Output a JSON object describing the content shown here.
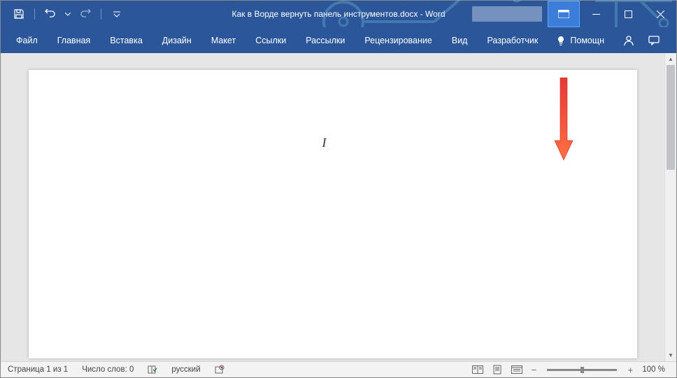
{
  "title": {
    "document": "Как в Ворде вернуть панель инструментов.docx",
    "separator": "  -  ",
    "app": "Word"
  },
  "tabs": {
    "items": [
      "Файл",
      "Главная",
      "Вставка",
      "Дизайн",
      "Макет",
      "Ссылки",
      "Рассылки",
      "Рецензирование",
      "Вид",
      "Разработчик"
    ],
    "tell_me": "Помощн"
  },
  "document": {
    "cursor_text": "I"
  },
  "status": {
    "page": "Страница 1 из 1",
    "words": "Число слов: 0",
    "language": "русский",
    "zoom": "100 %"
  },
  "colors": {
    "primary": "#2b579a",
    "highlight": "#3b7dd8"
  }
}
